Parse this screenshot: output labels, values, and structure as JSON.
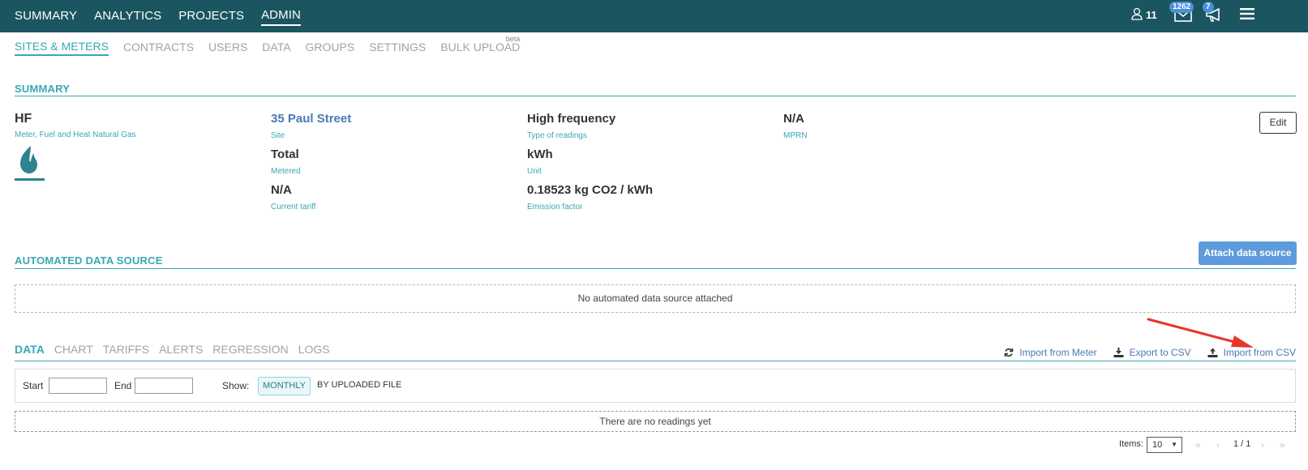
{
  "topnav": {
    "items": [
      {
        "label": "SUMMARY",
        "active": false
      },
      {
        "label": "ANALYTICS",
        "active": false
      },
      {
        "label": "PROJECTS",
        "active": false
      },
      {
        "label": "ADMIN",
        "active": true
      }
    ],
    "users_count": "11",
    "mail_badge": "1262",
    "notifications_badge": "7"
  },
  "subnav": {
    "items": [
      {
        "label": "SITES & METERS",
        "active": true
      },
      {
        "label": "CONTRACTS",
        "active": false
      },
      {
        "label": "USERS",
        "active": false
      },
      {
        "label": "DATA",
        "active": false
      },
      {
        "label": "GROUPS",
        "active": false
      },
      {
        "label": "SETTINGS",
        "active": false
      },
      {
        "label": "BULK UPLOAD",
        "active": false
      }
    ],
    "beta_label": "beta"
  },
  "summary": {
    "title": "SUMMARY",
    "meter_name": "HF",
    "meter_type": "Meter, Fuel and Heat Natural Gas",
    "site": {
      "value": "35 Paul Street",
      "label": "Site"
    },
    "metered": {
      "value": "Total",
      "label": "Metered"
    },
    "tariff": {
      "value": "N/A",
      "label": "Current tariff"
    },
    "readings_type": {
      "value": "High frequency",
      "label": "Type of readings"
    },
    "unit": {
      "value": "kWh",
      "label": "Unit"
    },
    "emission": {
      "value": "0.18523 kg CO2 / kWh",
      "label": "Emission factor"
    },
    "mprn": {
      "value": "N/A",
      "label": "MPRN"
    },
    "edit_label": "Edit"
  },
  "automated": {
    "title": "AUTOMATED DATA SOURCE",
    "attach_label": "Attach data source",
    "empty_message": "No automated data source attached"
  },
  "data_section": {
    "tabs": [
      {
        "label": "DATA",
        "active": true
      },
      {
        "label": "CHART",
        "active": false
      },
      {
        "label": "TARIFFS",
        "active": false
      },
      {
        "label": "ALERTS",
        "active": false
      },
      {
        "label": "REGRESSION",
        "active": false
      },
      {
        "label": "LOGS",
        "active": false
      }
    ],
    "actions": {
      "import_meter": "Import from Meter",
      "export_csv": "Export to CSV",
      "import_csv": "Import from CSV"
    },
    "filter": {
      "start_label": "Start",
      "start_value": "",
      "end_label": "End",
      "end_value": "",
      "show_label": "Show:",
      "monthly_label": "MONTHLY",
      "by_file_label": "BY UPLOADED FILE"
    },
    "empty_message": "There are no readings yet",
    "pagination": {
      "items_label": "Items:",
      "items_value": "10",
      "page_text": "1 / 1"
    }
  },
  "colors": {
    "topbar": "#1b5560",
    "accent": "#3aa7b4",
    "link": "#4a79b5",
    "button_primary": "#5d9bdc",
    "annotation_arrow": "#e8352a"
  }
}
